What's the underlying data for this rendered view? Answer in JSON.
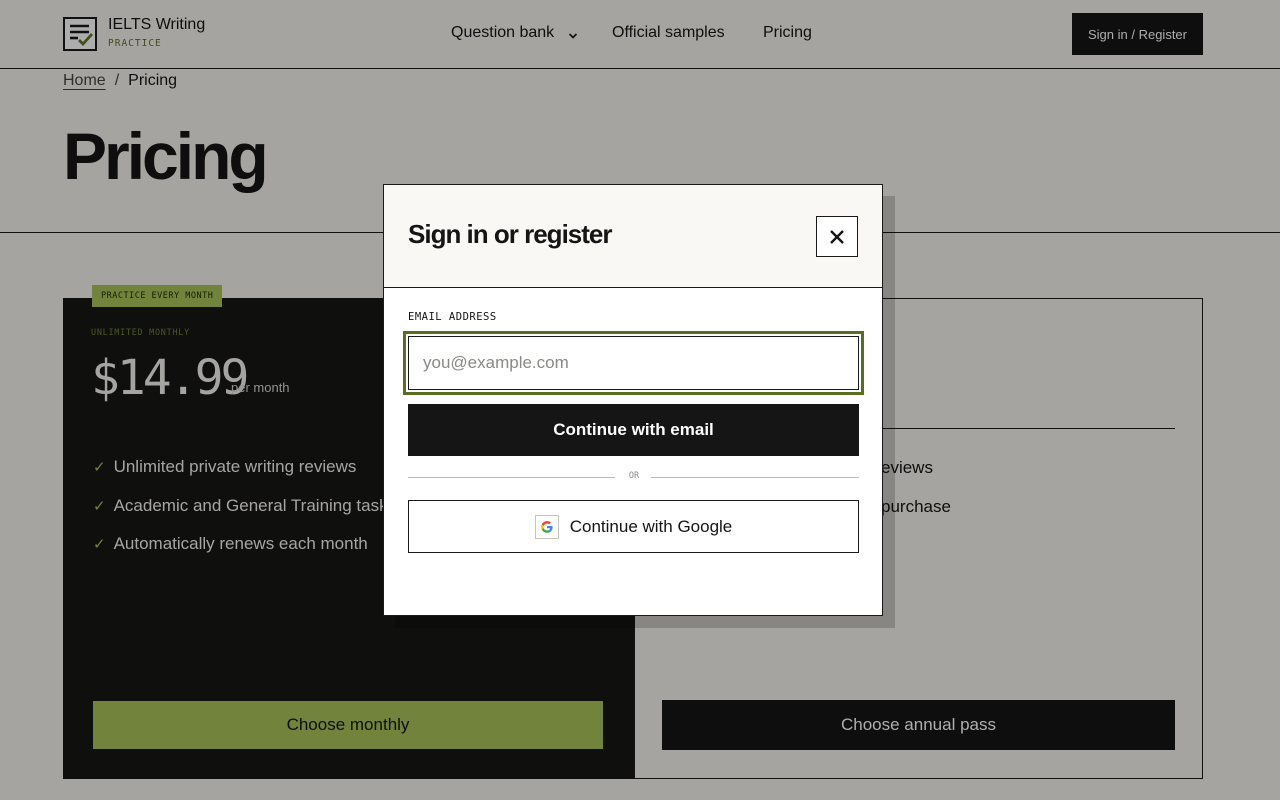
{
  "header": {
    "logo_title": "IELTS Writing",
    "logo_subtitle": "PRACTICE",
    "nav": [
      {
        "label": "Question bank",
        "has_dropdown": true
      },
      {
        "label": "Official samples"
      },
      {
        "label": "Pricing"
      }
    ],
    "signin_label": "Sign in / Register"
  },
  "breadcrumb": {
    "home": "Home",
    "separator": "/",
    "current": "Pricing"
  },
  "hero": {
    "title": "Pricing"
  },
  "plans": {
    "monthly": {
      "badge": "PRACTICE EVERY MONTH",
      "label": "UNLIMITED MONTHLY",
      "price": "$14.99",
      "unit": "per month",
      "features": [
        "Unlimited private writing reviews",
        "Academic and General Training task",
        "Automatically renews each month"
      ],
      "button": "Choose monthly"
    },
    "annual": {
      "features_visible": [
        "eviews",
        "purchase"
      ],
      "button": "Choose annual pass"
    }
  },
  "modal": {
    "title": "Sign in or register",
    "email_label": "EMAIL ADDRESS",
    "email_placeholder": "you@example.com",
    "email_value": "",
    "continue_email": "Continue with email",
    "or": "OR",
    "continue_google": "Continue with Google"
  },
  "colors": {
    "accent": "#a8c357",
    "accent_dark": "#5b6e1f",
    "ink": "#151515",
    "paper": "#f4f2ec"
  },
  "icons": {
    "logo": "checklist-icon",
    "nav_caret": "chevron-down-icon",
    "feature": "check-icon",
    "close": "close-icon",
    "google": "google-icon"
  }
}
